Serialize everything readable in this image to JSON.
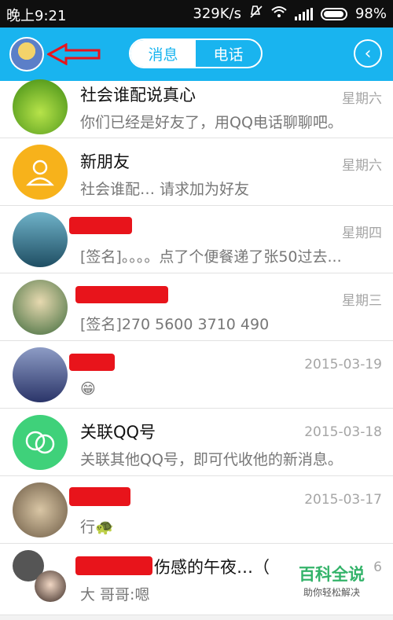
{
  "status_bar": {
    "time": "晚上9:21",
    "speed": "329K/s",
    "battery": "98%"
  },
  "header": {
    "tabs": [
      "消息",
      "电话"
    ],
    "active_tab": 0
  },
  "conversations": [
    {
      "name": "社会谁配说真心",
      "time": "星期六",
      "message": "你们已经是好友了，用QQ电话聊聊吧。"
    },
    {
      "name": "新朋友",
      "time": "星期六",
      "message": "社会谁配… 请求加为好友"
    },
    {
      "name": "",
      "time": "星期四",
      "message": "[签名]。。。。点了个便餐递了张50过去..."
    },
    {
      "name": "",
      "time": "星期三",
      "message": "[签名]270  5600 3710 490"
    },
    {
      "name": "",
      "time": "2015-03-19",
      "message": "😁"
    },
    {
      "name": "关联QQ号",
      "time": "2015-03-18",
      "message": "关联其他QQ号，即可代收他的新消息。"
    },
    {
      "name": "",
      "time": "2015-03-17",
      "message": "行🐢"
    },
    {
      "name": "伤感的午夜…（",
      "time": "6",
      "message": "大 哥哥:嗯"
    }
  ],
  "watermark": {
    "title": "百科全说",
    "subtitle": "助你轻松解决"
  },
  "colors": {
    "header": "#19b4ef",
    "redaction": "#e8141b",
    "new_friend": "#f7b21b",
    "link_qq": "#3fd17a"
  }
}
